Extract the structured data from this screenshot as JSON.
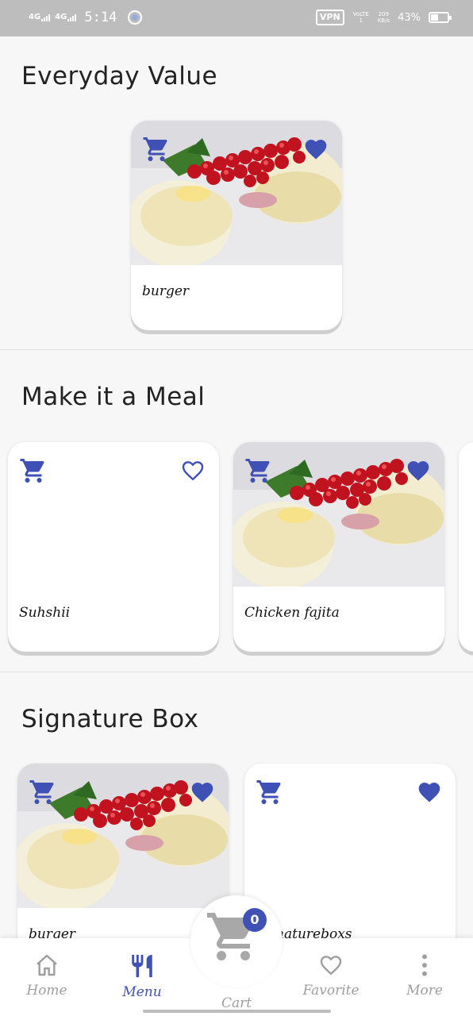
{
  "status_bar": {
    "network_1": "4G",
    "network_2": "4G",
    "time": "5:14",
    "vpn": "VPN",
    "volte": "VoLTE1",
    "speed_value": "209",
    "speed_unit": "KB/s",
    "battery": "43%"
  },
  "sections": [
    {
      "title": "Everyday Value",
      "cards": [
        {
          "name": "burger",
          "has_image": true,
          "favorited": true
        }
      ]
    },
    {
      "title": "Make it a Meal",
      "cards": [
        {
          "name": "Suhshii",
          "has_image": false,
          "favorited": false
        },
        {
          "name": "Chicken fajita",
          "has_image": true,
          "favorited": true
        }
      ]
    },
    {
      "title": "Signature Box",
      "cards": [
        {
          "name": "burger",
          "has_image": true,
          "favorited": true
        },
        {
          "name": "signatureboxs",
          "has_image": false,
          "favorited": true
        }
      ]
    }
  ],
  "bottom_nav": {
    "home": "Home",
    "menu": "Menu",
    "cart": "Cart",
    "cart_count": "0",
    "favorite": "Favorite",
    "more": "More",
    "active": "menu"
  },
  "colors": {
    "accent": "#3f51b5",
    "inactive": "#9e9e9e",
    "status_bar": "#bdbdbd"
  }
}
